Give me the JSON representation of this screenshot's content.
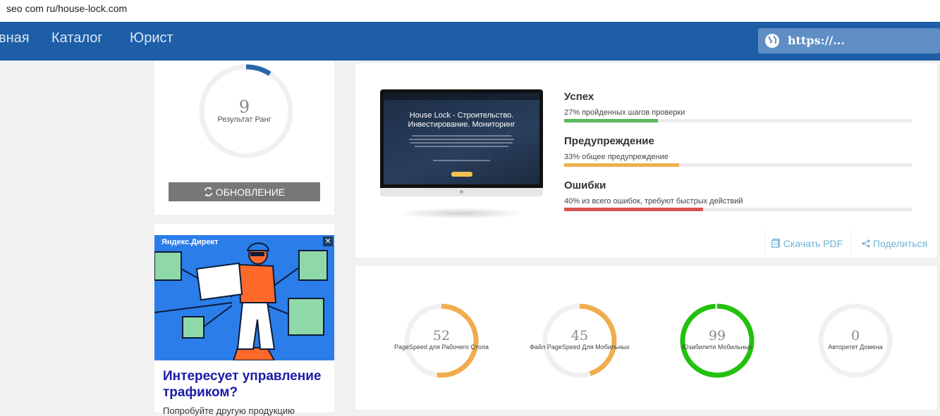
{
  "browser": {
    "url": "seo com ru/house-lock.com"
  },
  "nav": {
    "items": [
      "вная",
      "Каталог",
      "Юрист"
    ],
    "search_text": "https://..."
  },
  "rank": {
    "value": "9",
    "label": "Результат Ранг",
    "progress": 0.09,
    "update_label": "ОБНОВЛЕНИЕ"
  },
  "ad": {
    "source": "Яндекс.Директ",
    "close": "✕",
    "title": "Интересует управление трафиком?",
    "subtitle": "Попробуйте другую продукцию"
  },
  "site_preview": {
    "title_line1": "House Lock - Строительство.",
    "title_line2": "Инвестирование. Мониторинг"
  },
  "stats": [
    {
      "title": "Успех",
      "desc": "27% пройденных шагов проверки",
      "percent": 27,
      "color": "#5cb85c"
    },
    {
      "title": "Предупреждение",
      "desc": "33% общее предупреждение",
      "percent": 33,
      "color": "#f0ad4e"
    },
    {
      "title": "Ошибки",
      "desc": "40% из всего ошибок, требуют быстрых действий",
      "percent": 40,
      "color": "#d9534f"
    }
  ],
  "actions": {
    "pdf": "Скачать PDF",
    "share": "Поделиться"
  },
  "metrics": [
    {
      "value": "52",
      "label": "PageSpeed для Рабочего Стола",
      "percent": 52,
      "color": "#f0ad4e"
    },
    {
      "value": "45",
      "label": "Файл PageSpeed Для Мобильных",
      "percent": 45,
      "color": "#f0ad4e"
    },
    {
      "value": "99",
      "label": "Юзабилити Мобильных",
      "percent": 99,
      "color": "#22c10e"
    },
    {
      "value": "0",
      "label": "Авторитет Домена",
      "percent": 0,
      "color": "#cccccc"
    }
  ]
}
